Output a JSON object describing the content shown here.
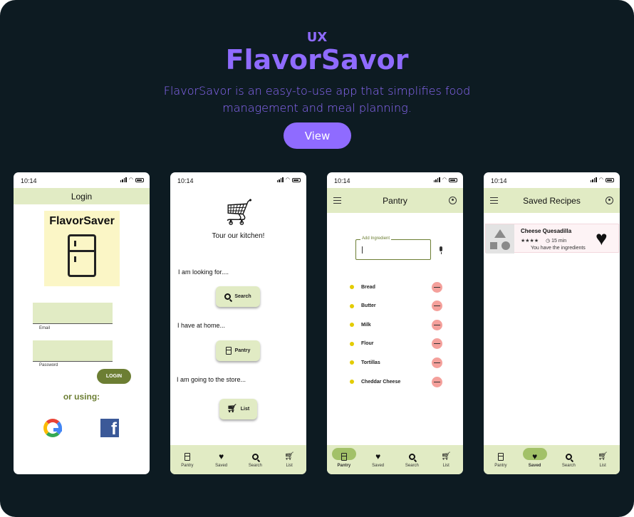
{
  "hero": {
    "tag": "UX",
    "title": "FlavorSavor",
    "description_line1": "FlavorSavor is an easy-to-use app that simplifies food",
    "description_line2": "management and meal planning.",
    "view_label": "View"
  },
  "colors": {
    "background": "#0d1b22",
    "accent": "#8f6bff",
    "app_bar": "#e1ebc4",
    "brand_green": "#6c7e33",
    "active_pill": "#a2c168",
    "remove_button": "#f4a09b",
    "bullet_dot": "#e3cc00"
  },
  "status_time": "10:14",
  "login_screen": {
    "title": "Login",
    "logo_text": "FlavorSaver",
    "email_label": "Email",
    "password_label": "Password",
    "login_button": "LOGIN",
    "or_using": "or using:",
    "social_icons": [
      "google-icon",
      "facebook-icon"
    ]
  },
  "tour_screen": {
    "heading": "Tour our kitchen!",
    "looking_for": "I am looking for....",
    "search_button": "Search",
    "at_home": "I have at home...",
    "pantry_button": "Pantry",
    "going_to_store": "I am going to the store...",
    "list_button": "List"
  },
  "pantry_screen": {
    "title": "Pantry",
    "add_ingredient_label": "Add Ingredient",
    "ingredients": [
      "Bread",
      "Butter",
      "Milk",
      "Flour",
      "Tortillas",
      "Cheddar Cheese"
    ]
  },
  "saved_screen": {
    "title": "Saved Recipes",
    "recipe": {
      "name": "Cheese Quesadilla",
      "stars": "★★★★",
      "time": "◷ 15 min",
      "note": "You have the ingredients"
    }
  },
  "nav": {
    "pantry": "Pantry",
    "saved": "Saved",
    "search": "Search",
    "list": "List"
  }
}
